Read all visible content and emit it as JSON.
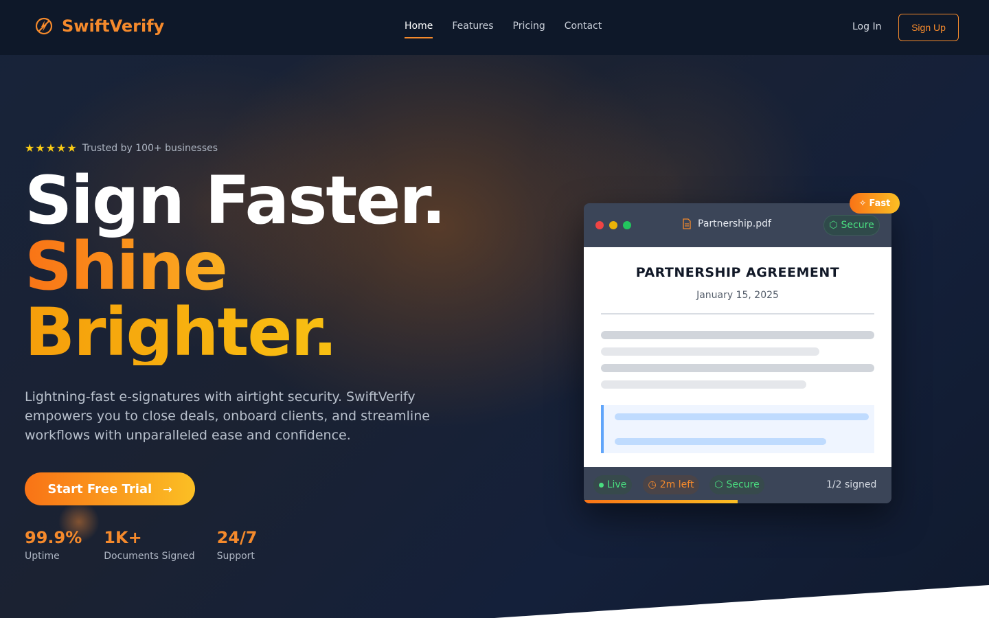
{
  "nav": {
    "brand": "SwiftVerify",
    "links": [
      {
        "label": "Home",
        "active": true
      },
      {
        "label": "Features",
        "active": false
      },
      {
        "label": "Pricing",
        "active": false
      },
      {
        "label": "Contact",
        "active": false
      }
    ],
    "login_label": "Log In",
    "signup_label": "Sign Up"
  },
  "hero": {
    "rating_stars": 5,
    "trust_text": "Trusted by 100+ businesses",
    "headline_line1": "Sign Faster.",
    "headline_line2": "Shine",
    "headline_line3": "Brighter.",
    "description": "Lightning-fast e-signatures with airtight security. SwiftVerify empowers you to close deals, onboard clients, and streamline workflows with unparalleled ease and confidence.",
    "cta_label": "Start Free Trial",
    "stats": [
      {
        "value": "99.9%",
        "label": "Uptime"
      },
      {
        "value": "1K+",
        "label": "Documents Signed"
      },
      {
        "value": "24/7",
        "label": "Support"
      }
    ]
  },
  "card": {
    "badge_label": "Fast",
    "file_name": "Partnership.pdf",
    "secure_label": "Secure",
    "doc_title": "PARTNERSHIP AGREEMENT",
    "doc_date": "January 15, 2025",
    "status": {
      "live_label": "Live",
      "time_left_label": "2m left",
      "secure_label": "Secure",
      "signed_label": "1/2 signed"
    },
    "signing_progress": 0.5
  },
  "colors": {
    "accent": "#f58a2c",
    "gold": "#fbbf24",
    "success": "#4ade80",
    "background": "#0f1a2b"
  },
  "icons": {
    "brand": "lightning-circle-icon",
    "star": "star-icon",
    "arrow": "arrow-right-icon",
    "file": "document-icon",
    "shield": "shield-icon",
    "clock": "clock-icon",
    "bolt": "lightning-icon"
  }
}
